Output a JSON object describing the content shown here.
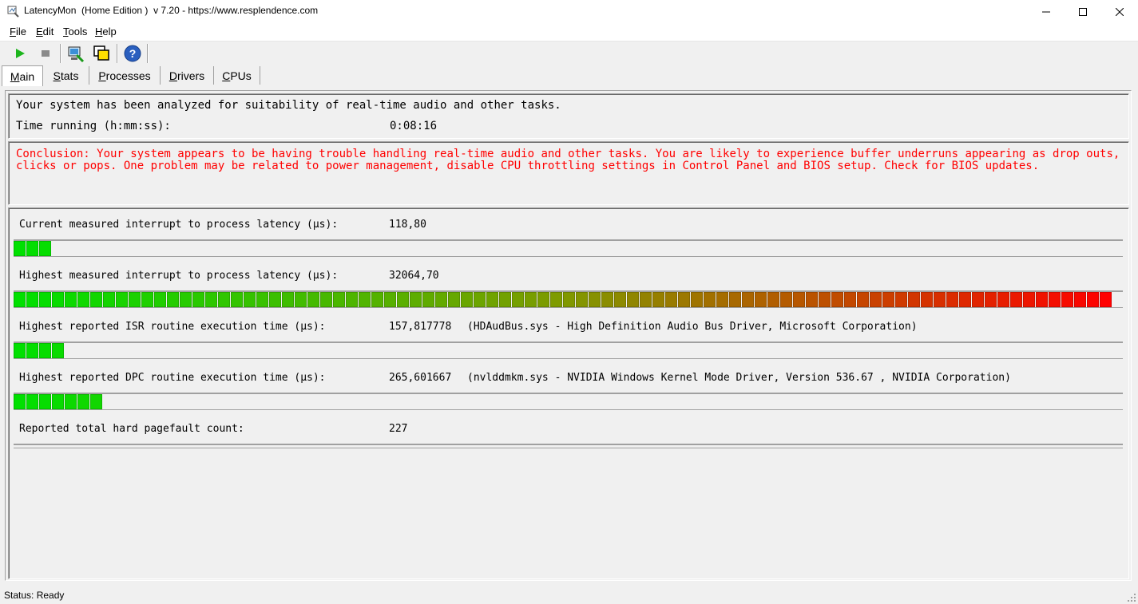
{
  "window": {
    "title": "LatencyMon  (Home Edition )  v 7.20 - https://www.resplendence.com"
  },
  "menu": [
    "File",
    "Edit",
    "Tools",
    "Help"
  ],
  "toolbar": {
    "icons": [
      "play-icon",
      "stop-icon",
      "monitor-icon",
      "window-icon",
      "help-icon"
    ]
  },
  "tabs": [
    "Main",
    "Stats",
    "Processes",
    "Drivers",
    "CPUs"
  ],
  "active_tab": "Main",
  "summary": {
    "analyzed": "Your system has been analyzed for suitability of real-time audio and other tasks.",
    "time_label": "Time running (h:mm:ss):",
    "time_value": "0:08:16"
  },
  "conclusion": "Conclusion: Your system appears to be having trouble handling real-time audio and other tasks. You are likely to experience buffer underruns appearing as drop outs, clicks or pops. One problem may be related to power management, disable CPU throttling settings in Control Panel and BIOS setup. Check for BIOS updates.",
  "metrics": [
    {
      "label": "Current measured interrupt to process latency (µs):",
      "value": "118,80",
      "detail": "",
      "fill": 0.033
    },
    {
      "label": "Highest measured interrupt to process latency (µs):",
      "value": "32064,70",
      "detail": "",
      "fill": 1.0
    },
    {
      "label": "Highest reported ISR routine execution time (µs):",
      "value": "157,817778",
      "detail": "(HDAudBus.sys - High Definition Audio Bus Driver, Microsoft Corporation)",
      "fill": 0.045
    },
    {
      "label": "Highest reported DPC routine execution time (µs):",
      "value": "265,601667",
      "detail": "(nvlddmkm.sys - NVIDIA Windows Kernel Mode Driver, Version 536.67 , NVIDIA Corporation)",
      "fill": 0.08
    },
    {
      "label": "Reported total hard pagefault count:",
      "value": "227",
      "detail": "",
      "fill": 0
    }
  ],
  "status": "Status: Ready",
  "colors": {
    "bar_start": "#00e000",
    "bar_end": "#ff0000"
  }
}
